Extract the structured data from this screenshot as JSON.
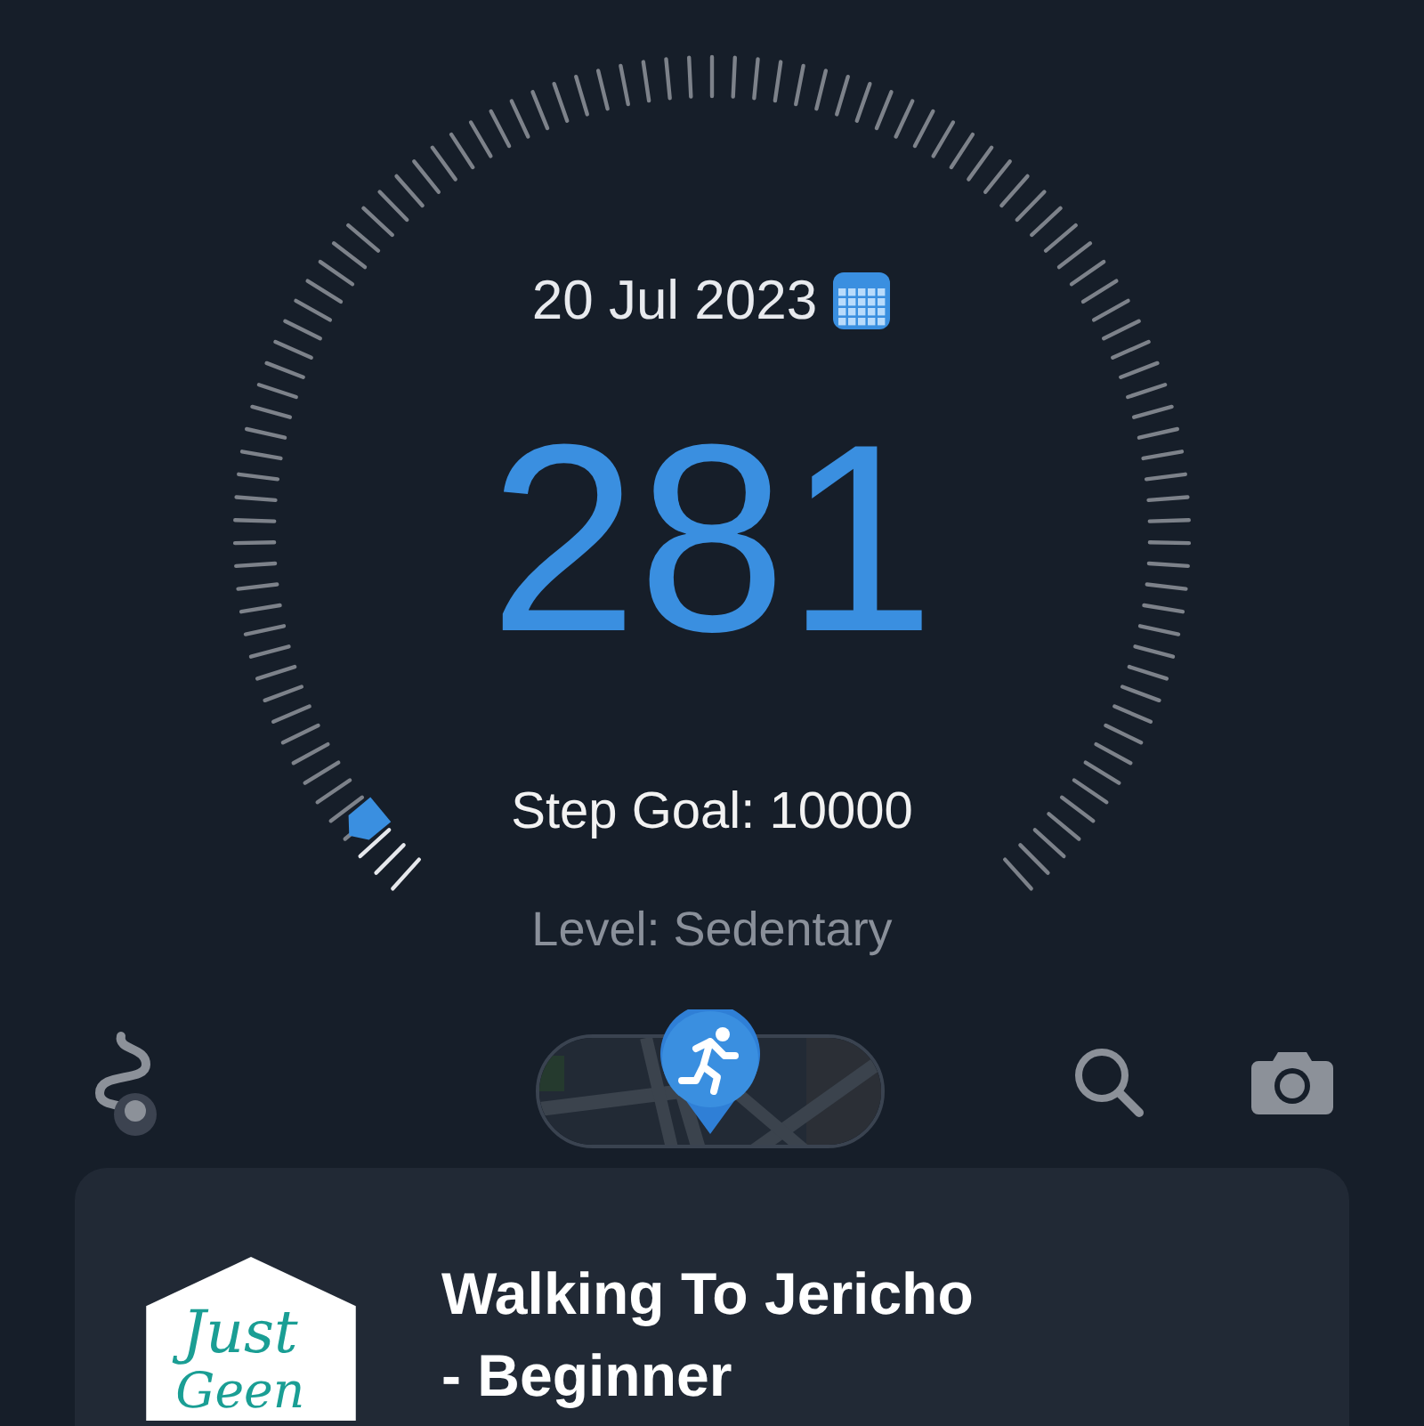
{
  "date": "20 Jul 2023",
  "steps": "281",
  "step_goal": "Step Goal: 10000",
  "activity_level": "Level: Sedentary",
  "card": {
    "title_lines": [
      "Walking To Jericho",
      "- Beginner"
    ],
    "logo_lines": [
      "Just",
      "Geen"
    ]
  }
}
